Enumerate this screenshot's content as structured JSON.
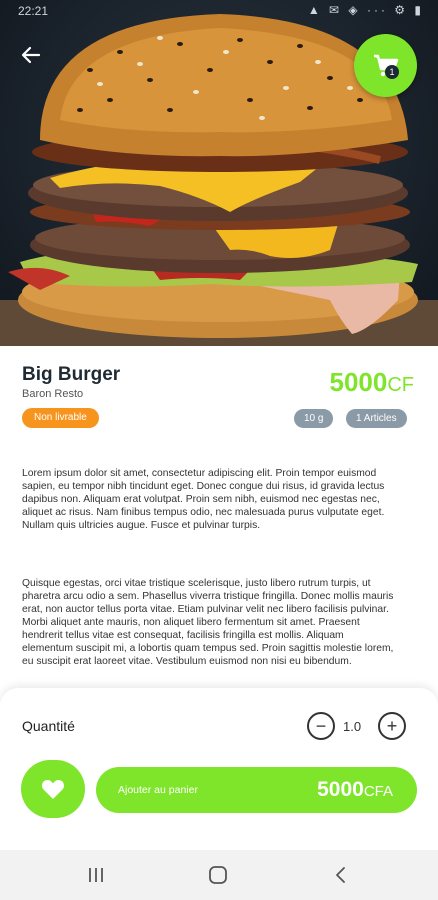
{
  "status_bar": {
    "time": "22:21",
    "icons": "▲ ✉ ◈ ··· ⚙ ▮"
  },
  "header": {
    "back_icon": "arrow-left-icon",
    "cart_icon": "cart-icon",
    "cart_badge": "1"
  },
  "product": {
    "name": "Big Burger",
    "restaurant": "Baron Resto",
    "price_amount": "5000",
    "price_currency": "CF",
    "availability": "Non livrable",
    "weight": "10 g",
    "articles": "1 Articles",
    "description_1": "Lorem ipsum dolor sit amet, consectetur adipiscing elit. Proin tempor euismod sapien, eu tempor nibh tincidunt eget. Donec congue dui risus, id gravida lectus dapibus non. Aliquam erat volutpat. Proin sem nibh, euismod nec egestas nec, aliquet ac risus. Nam finibus tempus odio, nec malesuada purus vulputate eget. Nullam quis ultricies augue. Fusce et pulvinar turpis.",
    "description_2": "Quisque egestas, orci vitae tristique scelerisque, justo libero rutrum turpis, ut pharetra arcu odio a sem. Phasellus viverra tristique fringilla. Donec mollis mauris erat, non auctor tellus porta vitae. Etiam pulvinar velit nec libero facilisis pulvinar. Morbi aliquet ante mauris, non aliquet libero fermentum sit amet. Praesent hendrerit tellus vitae est consequat, facilisis fringilla est mollis. Aliquam elementum suscipit mi, a lobortis quam tempus sed. Proin sagittis molestie lorem, eu suscipit erat laoreet vitae. Vestibulum euismod non nisi eu bibendum."
  },
  "quantity": {
    "label": "Quantité",
    "value": "1.0",
    "minus": "−",
    "plus": "+"
  },
  "actions": {
    "favorite_icon": "heart-icon",
    "add_label": "Ajouter au panier",
    "add_price_amount": "5000",
    "add_price_currency": "CFA"
  },
  "colors": {
    "accent": "#7ee52b",
    "orange": "#f7941d",
    "gray_pill": "#8a9aa6"
  }
}
